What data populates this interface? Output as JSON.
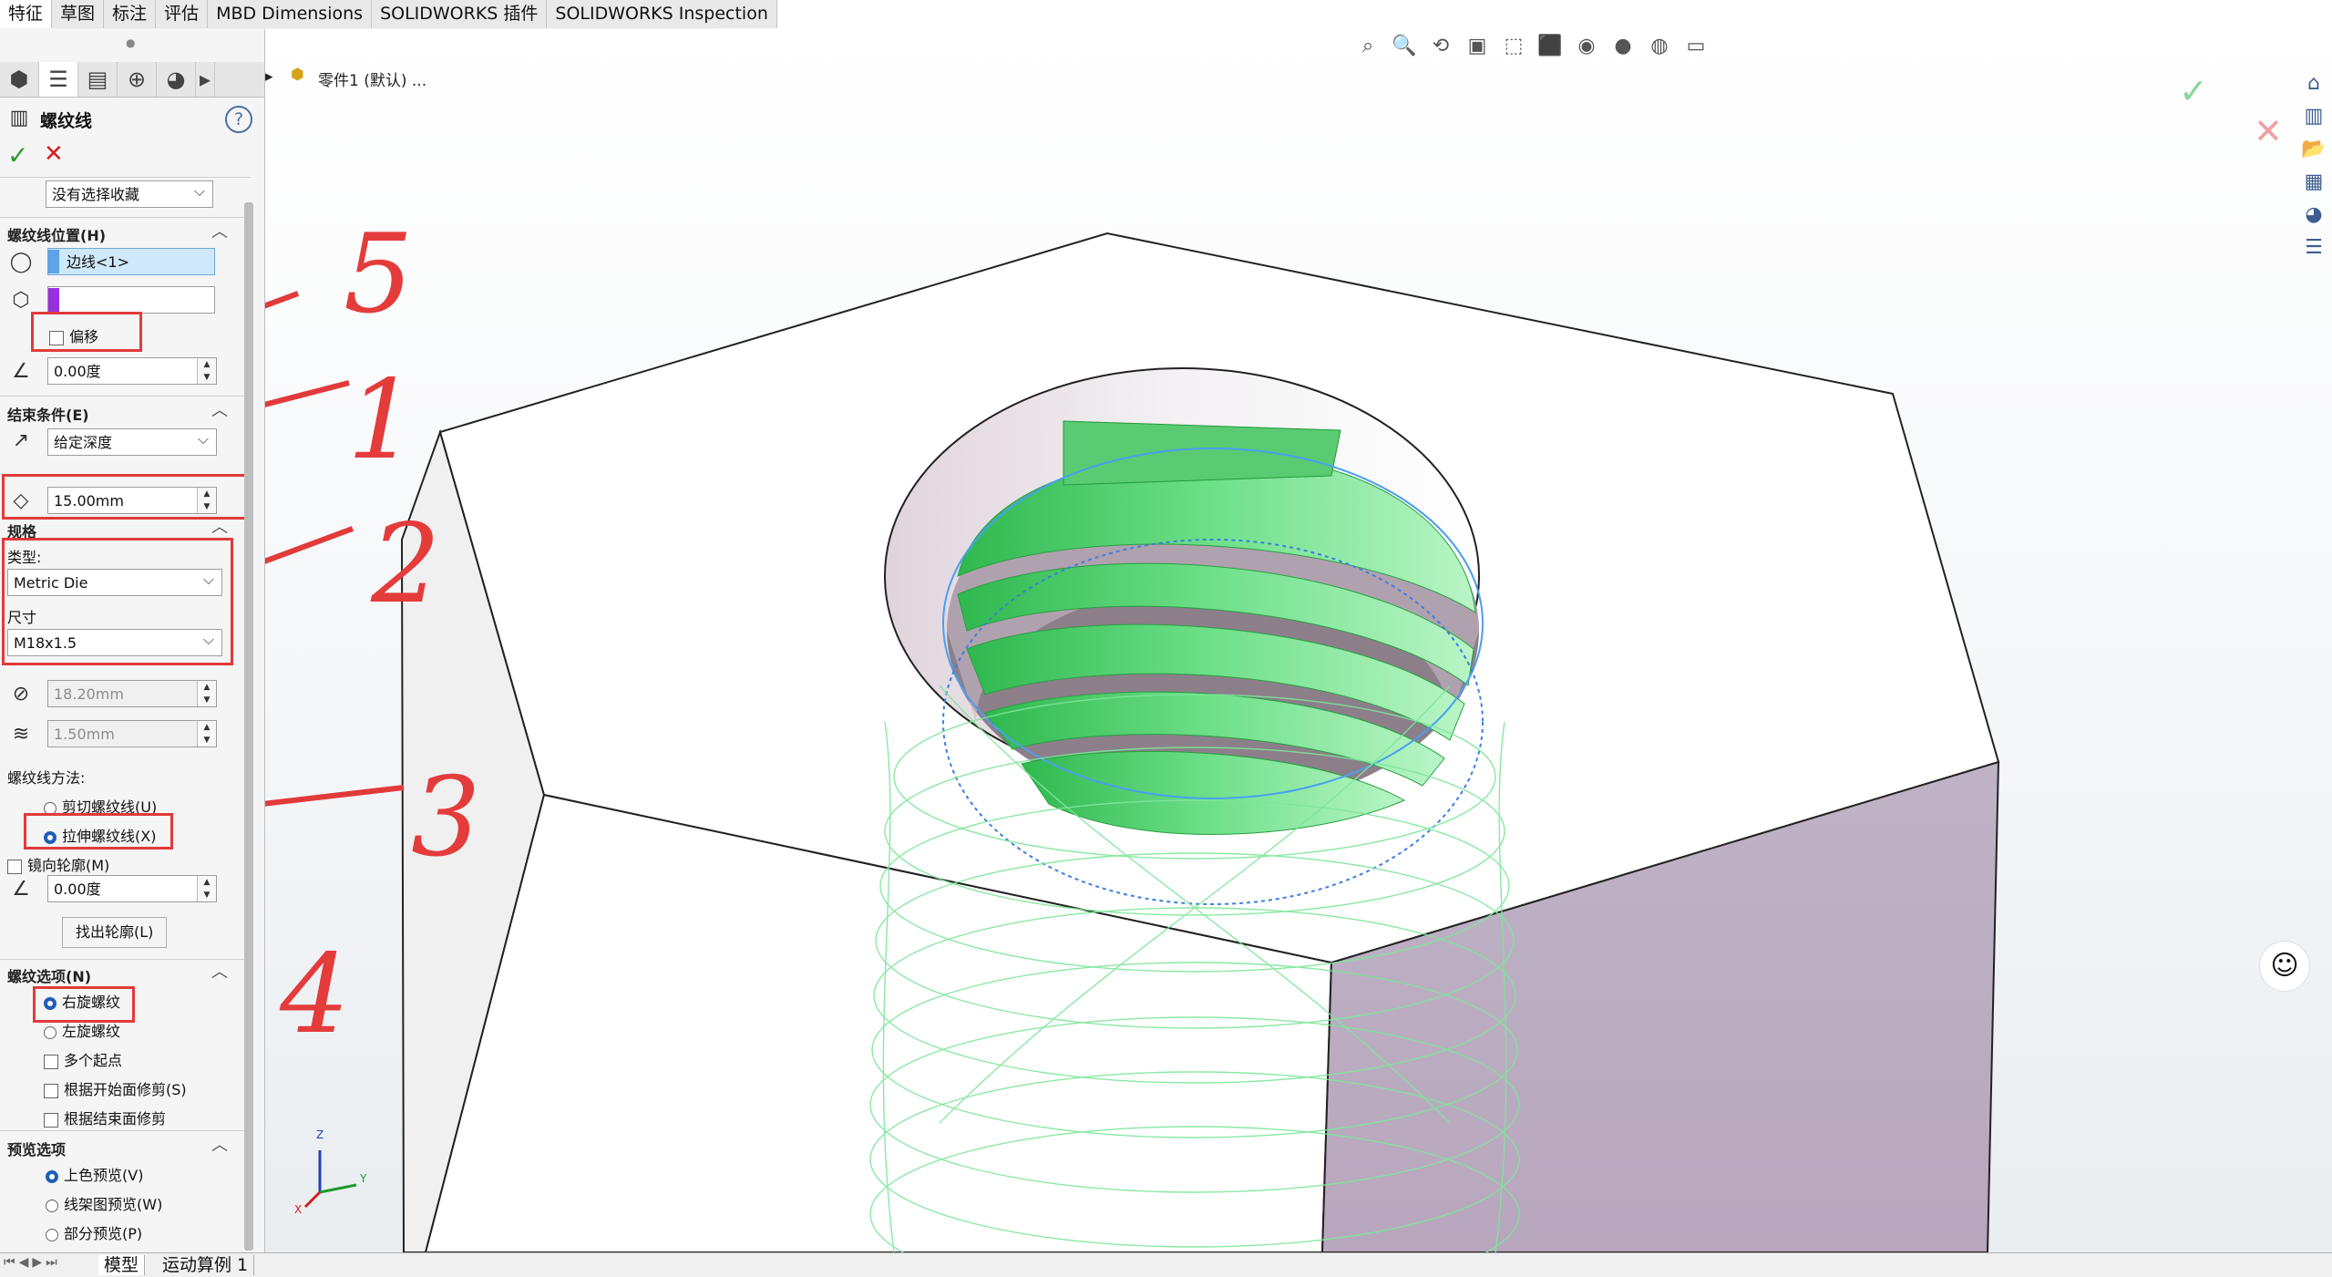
{
  "command_tabs": [
    "特征",
    "草图",
    "标注",
    "评估",
    "MBD Dimensions",
    "SOLIDWORKS 插件",
    "SOLIDWORKS Inspection"
  ],
  "panel": {
    "title": "螺纹线",
    "help_glyph": "?",
    "ok_glyph": "✓",
    "cancel_glyph": "✕",
    "favorites": "没有选择收藏",
    "position_section": "螺纹线位置(H)",
    "edge_value": "边线<1>",
    "offset_label": "偏移",
    "angle1": "0.00度",
    "end_section": "结束条件(E)",
    "end_condition": "给定深度",
    "depth": "15.00mm",
    "spec_section": "规格",
    "type_label": "类型:",
    "type_value": "Metric Die",
    "size_label": "尺寸",
    "size_value": "M18x1.5",
    "diameter": "18.20mm",
    "pitch": "1.50mm",
    "method_label": "螺纹线方法:",
    "method_cut": "剪切螺纹线(U)",
    "method_extrude": "拉伸螺纹线(X)",
    "mirror_profile": "镜向轮廓(M)",
    "angle2": "0.00度",
    "find_profile": "找出轮廓(L)",
    "options_section": "螺纹选项(N)",
    "right_hand": "右旋螺纹",
    "left_hand": "左旋螺纹",
    "multi_start": "多个起点",
    "trim_start": "根据开始面修剪(S)",
    "trim_end": "根据结束面修剪",
    "preview_section": "预览选项",
    "preview_shaded": "上色预览(V)",
    "preview_wire": "线架图预览(W)",
    "preview_partial": "部分预览(P)"
  },
  "tree": {
    "node": "零件1 (默认) ..."
  },
  "bottom_tabs": [
    "模型",
    "运动算例 1"
  ],
  "annotations": [
    "5",
    "1",
    "2",
    "3",
    "4"
  ],
  "triad": {
    "x": "X",
    "y": "Y",
    "z": "Z"
  },
  "colors": {
    "accent": "#1d5fb8",
    "thread_green": "#3ccf63",
    "annotation_red": "#e23a3a",
    "hex_side": "#bcaec2"
  }
}
